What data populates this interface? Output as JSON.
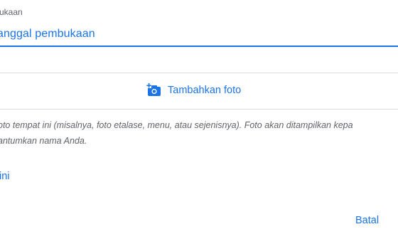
{
  "field": {
    "label": "ukaan",
    "value": "anggal pembukaan"
  },
  "add_photo": {
    "label": "Tambahkan foto",
    "icon": "add-photo-camera-icon"
  },
  "note": {
    "line1": "oto tempat ini (misalnya, foto etalase, menu, atau sejenisnya). Foto akan ditampilkan kepa",
    "line2": "antumkan nama Anda."
  },
  "link": {
    "label": "ini"
  },
  "actions": {
    "cancel_label": "Batal"
  },
  "colors": {
    "accent": "#1a73e8",
    "text_secondary": "#5f6368",
    "divider": "#dadce0"
  }
}
